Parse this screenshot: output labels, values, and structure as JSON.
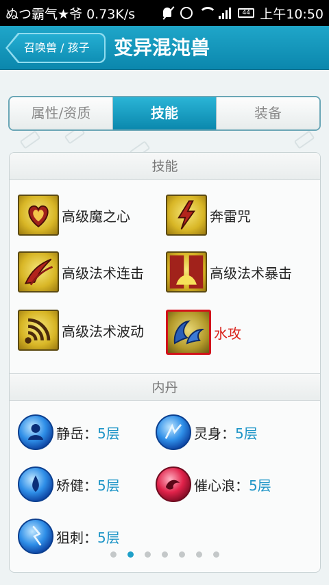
{
  "status_bar": {
    "left_text": "ぬつ霸气★爷  0.73K/s",
    "battery": "44",
    "time": "上午10:50"
  },
  "header": {
    "back_label": "召唤兽 / 孩子",
    "title": "变异混沌兽"
  },
  "tabs": [
    {
      "label": "属性/资质",
      "active": false
    },
    {
      "label": "技能",
      "active": true
    },
    {
      "label": "装备",
      "active": false
    }
  ],
  "skills_section": {
    "title": "技能",
    "items": [
      {
        "label": "高级魔之心",
        "icon": "heart-skill-icon"
      },
      {
        "label": "奔雷咒",
        "icon": "lightning-skill-icon"
      },
      {
        "label": "高级法术连击",
        "icon": "combo-skill-icon"
      },
      {
        "label": "高级法术暴击",
        "icon": "crit-skill-icon"
      },
      {
        "label": "高级法术波动",
        "icon": "wave-skill-icon"
      },
      {
        "label": "水攻",
        "icon": "water-skill-icon",
        "highlight_color": "#d9231c"
      }
    ]
  },
  "neidan_section": {
    "title": "内丹",
    "items": [
      {
        "name": "静岳：",
        "level": "5层",
        "icon": "jingyue-orb-icon"
      },
      {
        "name": "灵身：",
        "level": "5层",
        "icon": "lingshen-orb-icon"
      },
      {
        "name": "矫健：",
        "level": "5层",
        "icon": "jiaojian-orb-icon"
      },
      {
        "name": "催心浪：",
        "level": "5层",
        "icon": "cuixinlang-orb-icon"
      },
      {
        "name": "狙刺：",
        "level": "5层",
        "icon": "juci-orb-icon"
      }
    ]
  },
  "pager": {
    "total": 7,
    "active_index": 1
  },
  "colors": {
    "accent": "#1fa6c9",
    "level_text": "#1e95c7",
    "highlight": "#d9231c"
  }
}
